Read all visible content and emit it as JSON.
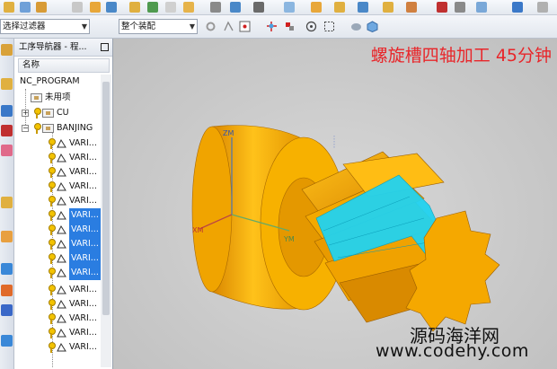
{
  "toolbar": {
    "filter_combo": "选择过滤器",
    "assembly_combo": "整个装配"
  },
  "navigator": {
    "title": "工序导航器 - 程...",
    "column_name": "名称",
    "root": "NC_PROGRAM",
    "items": [
      {
        "label": "未用项",
        "selected": false
      },
      {
        "label": "CU",
        "selected": false
      },
      {
        "label": "BANJING",
        "selected": false
      },
      {
        "label": "VARI...",
        "selected": false
      },
      {
        "label": "VARI...",
        "selected": false
      },
      {
        "label": "VARI...",
        "selected": false
      },
      {
        "label": "VARI...",
        "selected": false
      },
      {
        "label": "VARI...",
        "selected": false
      },
      {
        "label": "VARI...",
        "selected": true
      },
      {
        "label": "VARI...",
        "selected": true
      },
      {
        "label": "VARI...",
        "selected": true
      },
      {
        "label": "VARI...",
        "selected": true
      },
      {
        "label": "VARI...",
        "selected": true
      },
      {
        "label": "VARI...",
        "selected": false
      },
      {
        "label": "VARI...",
        "selected": false
      },
      {
        "label": "VARI...",
        "selected": false
      },
      {
        "label": "VARI...",
        "selected": false
      },
      {
        "label": "VARI...",
        "selected": false
      }
    ]
  },
  "viewport": {
    "overlay_title": "螺旋槽四轴加工 45分钟",
    "axis_z": "ZM",
    "axis_x": "XM",
    "axis_y": "YM",
    "watermark_cn": "源码海洋网",
    "watermark_url": "www.codehy.com"
  },
  "colors": {
    "part_orange": "#f5a800",
    "toolpath_cyan": "#22d3f0",
    "selection_blue": "#2a7de1",
    "overlay_red": "#e8262a"
  }
}
